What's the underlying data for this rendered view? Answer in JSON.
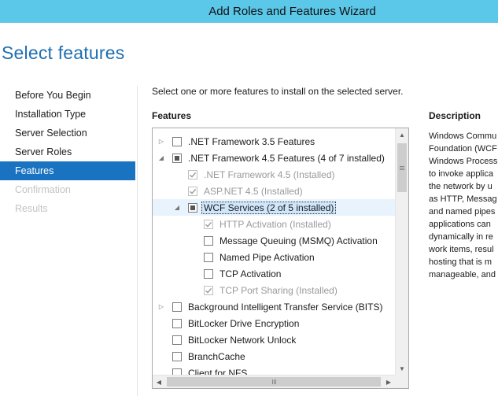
{
  "window": {
    "title": "Add Roles and Features Wizard"
  },
  "page": {
    "title": "Select features"
  },
  "nav": {
    "items": [
      {
        "label": "Before You Begin",
        "state": "normal"
      },
      {
        "label": "Installation Type",
        "state": "normal"
      },
      {
        "label": "Server Selection",
        "state": "normal"
      },
      {
        "label": "Server Roles",
        "state": "normal"
      },
      {
        "label": "Features",
        "state": "active"
      },
      {
        "label": "Confirmation",
        "state": "disabled"
      },
      {
        "label": "Results",
        "state": "disabled"
      }
    ]
  },
  "main": {
    "instruction": "Select one or more features to install on the selected server.",
    "features_header": "Features",
    "description_header": "Description",
    "description_lines": [
      "Windows Commu",
      "Foundation (WCF",
      "Windows Process",
      "to invoke applica",
      "the network by u",
      "as HTTP, Messag",
      "and named pipes",
      "applications can",
      "dynamically in re",
      "work items, resul",
      "hosting that is m",
      "manageable, and"
    ]
  },
  "tree": {
    "items": [
      {
        "label": ".NET Framework 3.5 Features",
        "level": 0,
        "expander": "collapsed",
        "check": "unchecked",
        "disabled": false,
        "selected": false
      },
      {
        "label": ".NET Framework 4.5 Features (4 of 7 installed)",
        "level": 0,
        "expander": "expanded",
        "check": "partial",
        "disabled": false,
        "selected": false
      },
      {
        "label": ".NET Framework 4.5 (Installed)",
        "level": 1,
        "expander": "none",
        "check": "checked",
        "disabled": true,
        "selected": false
      },
      {
        "label": "ASP.NET 4.5 (Installed)",
        "level": 1,
        "expander": "none",
        "check": "checked",
        "disabled": true,
        "selected": false
      },
      {
        "label": "WCF Services (2 of 5 installed)",
        "level": 1,
        "expander": "expanded",
        "check": "partial",
        "disabled": false,
        "selected": true
      },
      {
        "label": "HTTP Activation (Installed)",
        "level": 2,
        "expander": "none",
        "check": "checked",
        "disabled": true,
        "selected": false
      },
      {
        "label": "Message Queuing (MSMQ) Activation",
        "level": 2,
        "expander": "none",
        "check": "unchecked",
        "disabled": false,
        "selected": false
      },
      {
        "label": "Named Pipe Activation",
        "level": 2,
        "expander": "none",
        "check": "unchecked",
        "disabled": false,
        "selected": false
      },
      {
        "label": "TCP Activation",
        "level": 2,
        "expander": "none",
        "check": "unchecked",
        "disabled": false,
        "selected": false
      },
      {
        "label": "TCP Port Sharing (Installed)",
        "level": 2,
        "expander": "none",
        "check": "checked",
        "disabled": true,
        "selected": false
      },
      {
        "label": "Background Intelligent Transfer Service (BITS)",
        "level": 0,
        "expander": "collapsed",
        "check": "unchecked",
        "disabled": false,
        "selected": false
      },
      {
        "label": "BitLocker Drive Encryption",
        "level": 0,
        "expander": "none",
        "check": "unchecked",
        "disabled": false,
        "selected": false
      },
      {
        "label": "BitLocker Network Unlock",
        "level": 0,
        "expander": "none",
        "check": "unchecked",
        "disabled": false,
        "selected": false
      },
      {
        "label": "BranchCache",
        "level": 0,
        "expander": "none",
        "check": "unchecked",
        "disabled": false,
        "selected": false
      },
      {
        "label": "Client for NFS",
        "level": 0,
        "expander": "none",
        "check": "unchecked",
        "disabled": false,
        "selected": false
      }
    ]
  },
  "colors": {
    "titlebar": "#5bc7e9",
    "accent": "#1a73c0",
    "page_title": "#1f6fb2",
    "selection": "#cfe6fb"
  }
}
